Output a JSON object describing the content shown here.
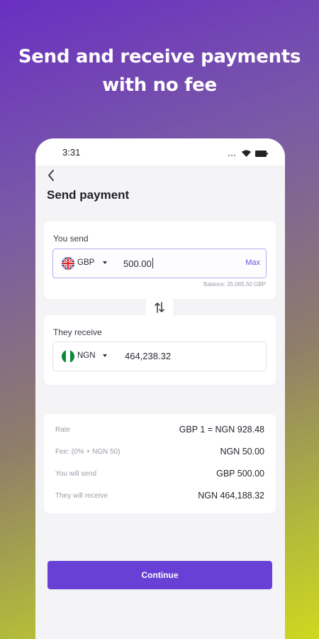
{
  "promo": {
    "headline_line1": "Send and receive payments",
    "headline_line2": "with no fee"
  },
  "status_bar": {
    "time": "3:31"
  },
  "header": {
    "title": "Send payment"
  },
  "send": {
    "label": "You send",
    "currency": "GBP",
    "amount": "500.00",
    "max_label": "Max",
    "balance": "Balance: 25,065.50 GBP"
  },
  "receive": {
    "label": "They receive",
    "currency": "NGN",
    "amount": "464,238.32"
  },
  "summary": {
    "rows": [
      {
        "key": "Rate",
        "value": "GBP 1 = NGN 928.48"
      },
      {
        "key": "Fee: (0% + NGN 50)",
        "value": "NGN 50.00"
      },
      {
        "key": "You will send",
        "value": "GBP 500.00"
      },
      {
        "key": "They will receive",
        "value": "NGN 464,188.32"
      }
    ]
  },
  "actions": {
    "continue_label": "Continue"
  },
  "colors": {
    "accent": "#6840d6",
    "max_link": "#6a4de0"
  },
  "icons": [
    "back-arrow-icon",
    "swap-arrows-icon",
    "uk-flag-icon",
    "nigeria-flag-icon",
    "wifi-icon",
    "battery-icon",
    "signal-icon"
  ]
}
